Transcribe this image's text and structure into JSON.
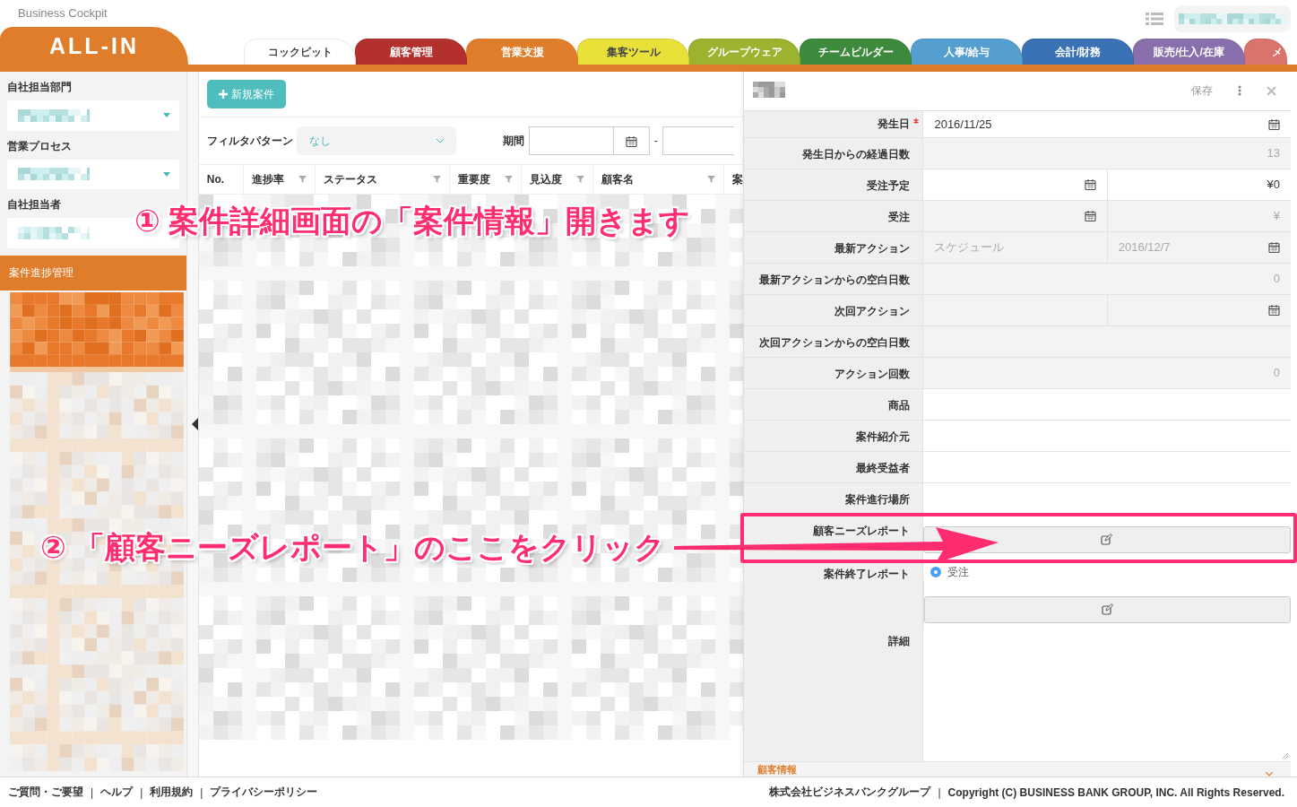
{
  "app_title": "Business Cockpit",
  "logo": "ALL-IN",
  "tabs": [
    {
      "label": "コックピット",
      "color": "#ffffff",
      "selected": false
    },
    {
      "label": "顧客管理",
      "color": "#b3312c",
      "selected": false
    },
    {
      "label": "営業支援",
      "color": "#e07d2b",
      "selected": true
    },
    {
      "label": "集客ツール",
      "color": "#e9e03a",
      "selected": false
    },
    {
      "label": "グループウェア",
      "color": "#9db22f",
      "selected": false
    },
    {
      "label": "チームビルダー",
      "color": "#3d8a3c",
      "selected": false
    },
    {
      "label": "人事/給与",
      "color": "#549ed0",
      "selected": false
    },
    {
      "label": "会計/財務",
      "color": "#3a72b5",
      "selected": false
    },
    {
      "label": "販売/仕入/在庫",
      "color": "#8a6fad",
      "selected": false
    },
    {
      "label": "メ",
      "color": "#d9736b",
      "selected": false
    }
  ],
  "sidebar": {
    "filters": [
      {
        "label": "自社担当部門",
        "kind": "select"
      },
      {
        "label": "営業プロセス",
        "kind": "select"
      },
      {
        "label": "自社担当者",
        "kind": "field"
      }
    ],
    "section": "案件進捗管理"
  },
  "new_button": "新規案件",
  "filter": {
    "label": "フィルタパターン",
    "value": "なし",
    "period_label": "期間",
    "separator": "-"
  },
  "table": {
    "columns": [
      {
        "label": "No.",
        "filter": false
      },
      {
        "label": "進捗率",
        "filter": true
      },
      {
        "label": "ステータス",
        "filter": true
      },
      {
        "label": "重要度",
        "filter": true
      },
      {
        "label": "見込度",
        "filter": true
      },
      {
        "label": "顧客名",
        "filter": true
      },
      {
        "label": "案"
      }
    ]
  },
  "detail": {
    "save": "保存",
    "rows": [
      {
        "label": "発生日",
        "required": true,
        "cells": [
          {
            "kind": "date",
            "value": "2016/11/25",
            "disabled": false
          }
        ]
      },
      {
        "label": "発生日からの経過日数",
        "required": false,
        "cells": [
          {
            "kind": "number",
            "value": "13",
            "disabled": true
          }
        ]
      },
      {
        "label": "受注予定",
        "required": false,
        "cells": [
          {
            "kind": "date",
            "disabled": false
          },
          {
            "kind": "number",
            "value": "¥0",
            "disabled": false
          }
        ]
      },
      {
        "label": "受注",
        "required": false,
        "cells": [
          {
            "kind": "date",
            "disabled": true
          },
          {
            "kind": "number",
            "value": "¥",
            "disabled": true
          }
        ]
      },
      {
        "label": "最新アクション",
        "required": false,
        "cells": [
          {
            "kind": "text",
            "value": "スケジュール",
            "disabled": true
          },
          {
            "kind": "date",
            "value": "2016/12/7",
            "disabled": true
          }
        ]
      },
      {
        "label": "最新アクションからの空白日数",
        "required": false,
        "cells": [
          {
            "kind": "number",
            "value": "0",
            "disabled": true
          }
        ]
      },
      {
        "label": "次回アクション",
        "required": false,
        "cells": [
          {
            "kind": "text",
            "disabled": true
          },
          {
            "kind": "date",
            "disabled": true
          }
        ]
      },
      {
        "label": "次回アクションからの空白日数",
        "required": false,
        "cells": [
          {
            "kind": "number",
            "disabled": true
          }
        ]
      },
      {
        "label": "アクション回数",
        "required": false,
        "cells": [
          {
            "kind": "number",
            "value": "0",
            "disabled": true
          }
        ]
      },
      {
        "label": "商品",
        "required": false,
        "cells": [
          {
            "kind": "text",
            "disabled": false
          }
        ]
      },
      {
        "label": "案件紹介元",
        "required": false,
        "cells": [
          {
            "kind": "text",
            "disabled": false
          }
        ]
      },
      {
        "label": "最終受益者",
        "required": false,
        "cells": [
          {
            "kind": "text",
            "disabled": false
          }
        ]
      },
      {
        "label": "案件進行場所",
        "required": false,
        "cells": [
          {
            "kind": "text",
            "disabled": false
          }
        ]
      },
      {
        "label": "顧客ニーズレポート",
        "required": false,
        "cells": [
          {
            "kind": "button",
            "disabled": false
          }
        ]
      },
      {
        "label": "案件終了レポート",
        "required": false,
        "cells": [
          {
            "kind": "radio",
            "value": "受注",
            "selected": true,
            "disabled": false
          },
          {
            "kind": "button",
            "disabled": false
          }
        ]
      },
      {
        "label": "詳細",
        "required": false,
        "cells": [
          {
            "kind": "textarea",
            "disabled": false
          }
        ]
      }
    ],
    "section": "顧客情報"
  },
  "annotations": [
    {
      "text": "① 案件詳細画面の「案件情報」開きます"
    },
    {
      "text": "② 「顧客ニーズレポート」のここをクリック"
    }
  ],
  "footer": {
    "links": [
      "ご質問・ご要望",
      "ヘルプ",
      "利用規約",
      "プライバシーポリシー"
    ],
    "separator": "|",
    "company": "株式会社ビジネスバンクグループ",
    "copyright": "Copyright (C) BUSINESS BANK GROUP, INC. All Rights Reserved."
  }
}
